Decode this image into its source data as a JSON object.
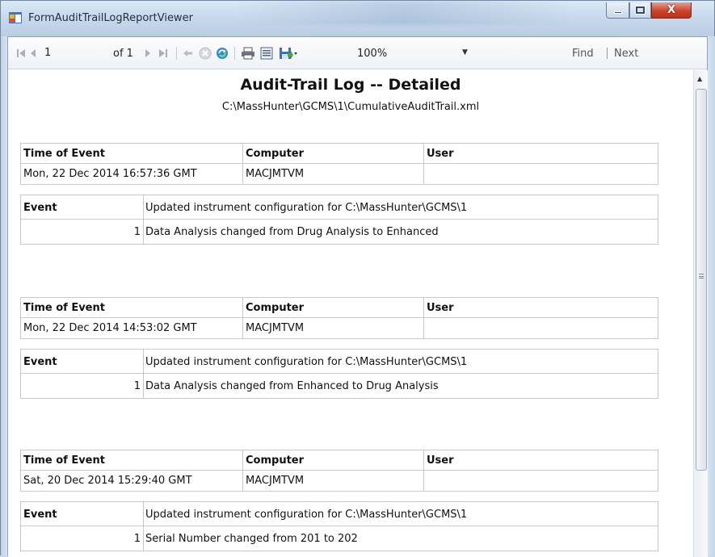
{
  "window": {
    "title": "FormAuditTrailLogReportViewer",
    "minimize_icon": "minimize-icon",
    "maximize_icon": "maximize-icon",
    "close_icon": "close-icon",
    "close_label": "X"
  },
  "toolbar": {
    "first_page_icon": "first-page-icon",
    "prev_page_icon": "previous-page-icon",
    "current_page": "1",
    "of_pages": "of 1",
    "next_page_icon": "next-page-icon",
    "last_page_icon": "last-page-icon",
    "back_icon": "back-icon",
    "stop_icon": "stop-icon",
    "refresh_icon": "refresh-icon",
    "print_icon": "print-icon",
    "print_layout_icon": "print-layout-icon",
    "export_icon": "export-save-icon",
    "zoom": "100%",
    "find_label": "Find",
    "separator": "|",
    "next_label": "Next"
  },
  "report": {
    "title": "Audit-Trail Log -- Detailed",
    "subtitle": "C:\\MassHunter\\GCMS\\1\\CumulativeAuditTrail.xml",
    "headers": {
      "time": "Time of Event",
      "computer": "Computer",
      "user": "User",
      "event": "Event"
    },
    "entries": [
      {
        "time": "Mon, 22 Dec 2014 16:57:36 GMT",
        "computer": "MACJMTVM",
        "user": "",
        "event": "Updated instrument configuration for C:\\MassHunter\\GCMS\\1",
        "detail_no": "1",
        "detail": "Data Analysis changed from Drug Analysis to Enhanced"
      },
      {
        "time": "Mon, 22 Dec 2014 14:53:02 GMT",
        "computer": "MACJMTVM",
        "user": "",
        "event": "Updated instrument configuration for C:\\MassHunter\\GCMS\\1",
        "detail_no": "1",
        "detail": "Data Analysis changed from Enhanced to Drug Analysis"
      },
      {
        "time": "Sat, 20 Dec 2014 15:29:40 GMT",
        "computer": "MACJMTVM",
        "user": "",
        "event": "Updated instrument configuration for C:\\MassHunter\\GCMS\\1",
        "detail_no": "1",
        "detail": "Serial Number changed from 201 to 202"
      }
    ]
  },
  "scrollbar": {
    "up_icon": "scroll-up-icon",
    "grip_icon": "scroll-grip-icon"
  }
}
